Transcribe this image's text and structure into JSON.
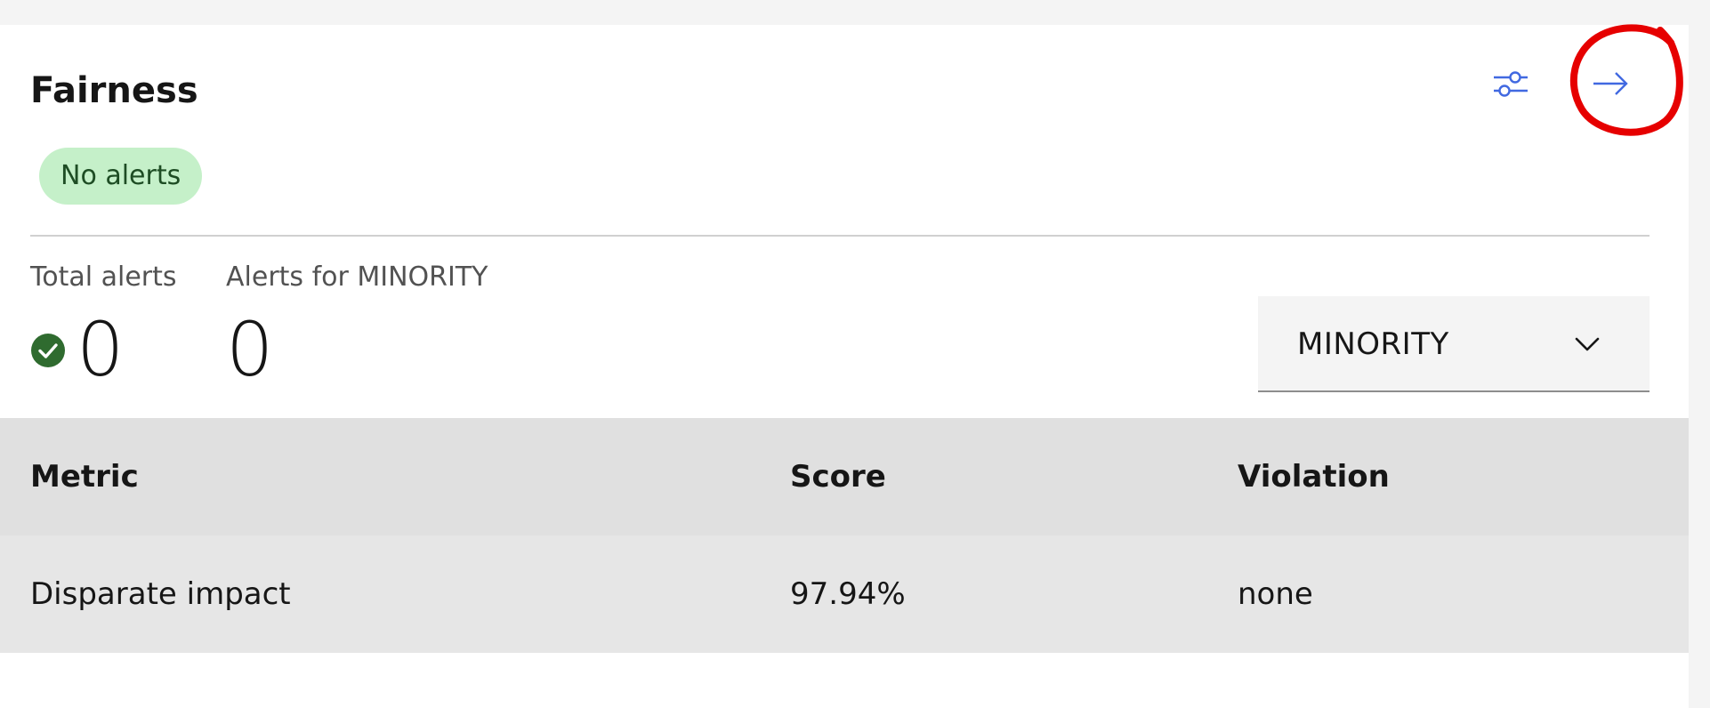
{
  "card": {
    "title": "Fairness",
    "settings_icon": "settings-adjust-icon",
    "open_icon": "arrow-right-icon"
  },
  "status_badge": {
    "label": "No alerts",
    "background": "#c5f0c9",
    "text_color": "#1e4d24"
  },
  "stats": {
    "total": {
      "label": "Total alerts",
      "value": "0",
      "icon": "checkmark-filled-icon"
    },
    "group": {
      "label": "Alerts for MINORITY",
      "value": "0"
    }
  },
  "group_select": {
    "selected": "MINORITY",
    "icon": "chevron-down-icon"
  },
  "table": {
    "columns": [
      "Metric",
      "Score",
      "Violation"
    ],
    "rows": [
      [
        "Disparate impact",
        "97.94%",
        "none"
      ]
    ]
  },
  "colors": {
    "accent": "#4169e1",
    "success": "#2f6b2f",
    "annotation": "#e60000"
  }
}
